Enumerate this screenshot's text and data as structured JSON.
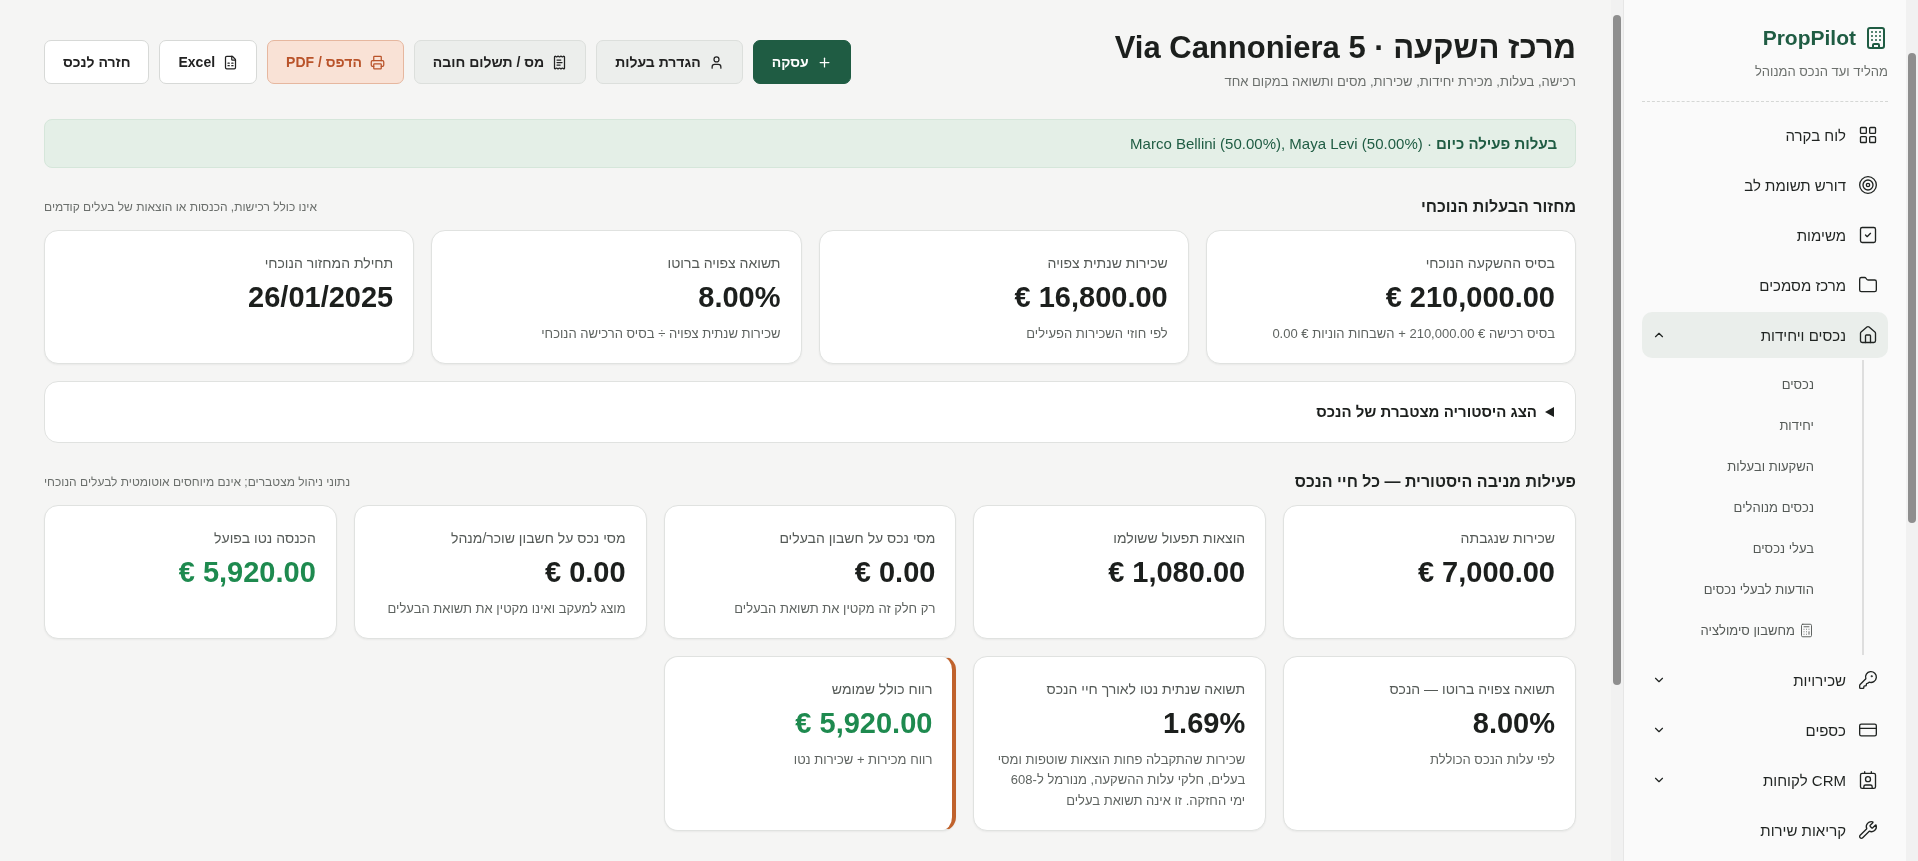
{
  "header": {
    "title": "מרכז השקעה · Via Cannoniera 5",
    "subtitle": "רכישה, בעלות, מכירת יחידות, שכירות, מסים ותשואה במקום אחד",
    "actions": [
      {
        "label": "עסקה",
        "kind": "primary"
      },
      {
        "label": "הגדרת בעלות",
        "kind": "secondary"
      },
      {
        "label": "מס / תשלום חובה",
        "kind": "secondary"
      },
      {
        "label": "הדפס / PDF",
        "kind": "accent"
      },
      {
        "label": "Excel",
        "kind": "outline"
      },
      {
        "label": "חזרה לנכס",
        "kind": "outline"
      }
    ]
  },
  "ownership_banner": "**בעלות פעילה כיום** · Marco Bellini (50.00%), Maya Levi (50.00%)",
  "current_cycle": {
    "title": "מחזור הבעלות הנוכחי",
    "note": "אינו כולל רכישות, הכנסות או הוצאות של בעלים קודמים",
    "cards": [
      {
        "label": "בסיס ההשקעה הנוכחי",
        "value": "€ 210,000.00",
        "note": "בסיס רכישה € 210,000.00 + השבחות הוניות € 0.00",
        "positive": false,
        "highlighted": false
      },
      {
        "label": "שכירות שנתית צפויה",
        "value": "€ 16,800.00",
        "note": "לפי חוזי השכירות הפעילים",
        "positive": false,
        "highlighted": false
      },
      {
        "label": "תשואה צפויה ברוטו",
        "value": "8.00%",
        "note": "שכירות שנתית צפויה ÷ בסיס הרכישה הנוכחי",
        "positive": false,
        "highlighted": false
      },
      {
        "label": "תחילת המחזור הנוכחי",
        "value": "26/01/2025",
        "positive": false,
        "highlighted": false
      }
    ]
  },
  "history_toggle": {
    "label": "הצג היסטוריה מצטברת של הנכס",
    "expanded": false
  },
  "lifetime": {
    "title": "פעילות מניבה היסטורית — כל חיי הנכס",
    "note": "נתוני ניהול מצטברים; אינם מיוחסים אוטומטית לבעלים הנוכחי",
    "cards": [
      {
        "label": "שכירות שנגבתה",
        "value": "€ 7,000.00",
        "positive": false,
        "highlighted": false
      },
      {
        "label": "הוצאות תפעול ששולמו",
        "value": "€ 1,080.00",
        "positive": false,
        "highlighted": false
      },
      {
        "label": "מסי נכס על חשבון הבעלים",
        "value": "€ 0.00",
        "note": "רק חלק זה מקטין את תשואת הבעלים",
        "positive": false,
        "highlighted": false
      },
      {
        "label": "מסי נכס על חשבון שוכר/מנהל",
        "value": "€ 0.00",
        "note": "מוצג למעקב ואינו מקטין את תשואת הבעלים",
        "positive": false,
        "highlighted": false
      },
      {
        "label": "הכנסה נטו בפועל",
        "value": "€ 5,920.00",
        "positive": true,
        "highlighted": false
      },
      {
        "label": "תשואה צפויה ברוטו — הנכס",
        "value": "8.00%",
        "note": "לפי עלות הנכס הכוללת",
        "positive": false,
        "highlighted": false
      },
      {
        "label": "תשואה שנתית נטו לאורך חיי הנכס",
        "value": "1.69%",
        "note": "שכירות שהתקבלה פחות הוצאות שוטפות ומסי בעלים, חלקי עלות ההשקעה, מנורמל ל-608 ימי החזקה. זו אינה תשואת בעלים",
        "positive": false,
        "highlighted": false
      },
      {
        "label": "רווח כולל שמומש",
        "value": "€ 5,920.00",
        "note": "רווח מכירות + שכירות נטו",
        "positive": true,
        "highlighted": true
      }
    ]
  },
  "sidebar": {
    "brand": "PropPilot",
    "tagline": "מהליד ועד הנכס המנוהל",
    "items": [
      {
        "label": "לוח בקרה",
        "selected": false
      },
      {
        "label": "דורש תשומת לב",
        "selected": false
      },
      {
        "label": "משימות",
        "selected": false
      },
      {
        "label": "מרכז מסמכים",
        "selected": false
      },
      {
        "label": "נכסים ויחידות",
        "selected": true,
        "expanded": true,
        "children": [
          {
            "label": "נכסים",
            "kind": "link"
          },
          {
            "label": "יחידות",
            "kind": "link"
          },
          {
            "label": "השקעות ובעלות",
            "kind": "link"
          },
          {
            "label": "נכסים מנוהלים",
            "kind": "link"
          },
          {
            "label": "בעלי נכסים",
            "kind": "link"
          },
          {
            "label": "הודעות לבעלי נכסים",
            "kind": "link"
          },
          {
            "label": "מחשבון סימולציה",
            "kind": "tool"
          }
        ]
      },
      {
        "label": "שכירויות",
        "selected": false,
        "expanded": false
      },
      {
        "label": "כספים",
        "selected": false,
        "expanded": false
      },
      {
        "label": "CRM לקוחות",
        "selected": false,
        "expanded": false
      },
      {
        "label": "קריאות שירות",
        "selected": false
      }
    ]
  }
}
